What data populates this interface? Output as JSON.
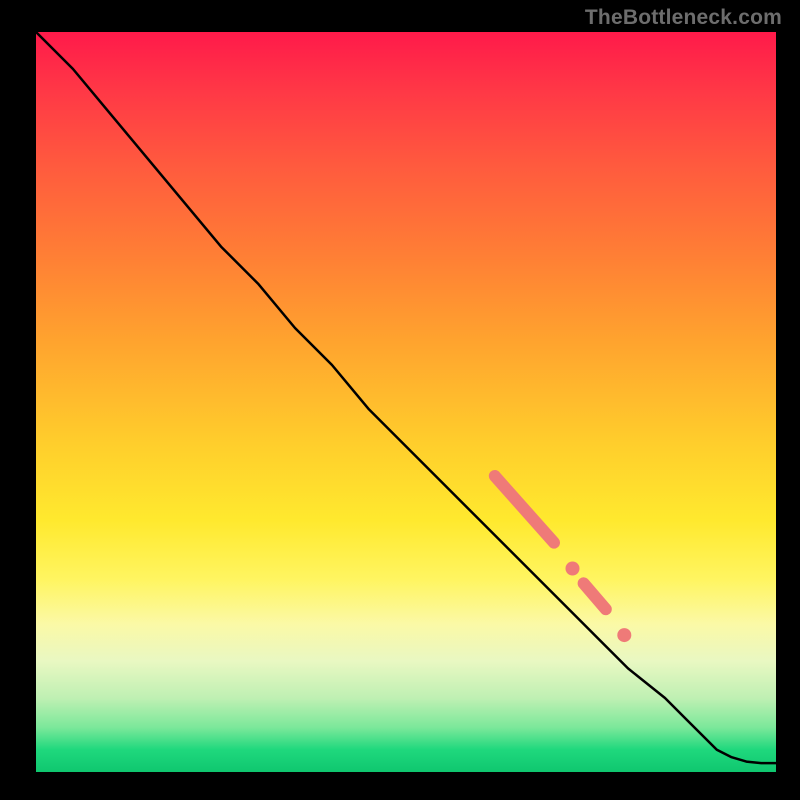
{
  "watermark": "TheBottleneck.com",
  "colors": {
    "line": "#000000",
    "marker": "#ef7a78",
    "gradient_top": "#ff1a4a",
    "gradient_mid": "#ffe92e",
    "gradient_bot": "#0fc76f"
  },
  "chart_data": {
    "type": "line",
    "title": "",
    "xlabel": "",
    "ylabel": "",
    "xlim": [
      0,
      100
    ],
    "ylim": [
      0,
      100
    ],
    "grid": false,
    "series": [
      {
        "name": "curve",
        "x": [
          0,
          5,
          10,
          15,
          20,
          25,
          30,
          35,
          40,
          45,
          50,
          55,
          60,
          65,
          70,
          75,
          80,
          85,
          88,
          90,
          92,
          94,
          96,
          98,
          100
        ],
        "values": [
          100,
          95,
          89,
          83,
          77,
          71,
          66,
          60,
          55,
          49,
          44,
          39,
          34,
          29,
          24,
          19,
          14,
          10,
          7,
          5,
          3,
          2,
          1.4,
          1.2,
          1.2
        ]
      }
    ],
    "markers": [
      {
        "shape": "segment",
        "x0": 62,
        "y0": 40,
        "x1": 70,
        "y1": 31
      },
      {
        "shape": "dot",
        "x": 72.5,
        "y": 27.5
      },
      {
        "shape": "segment",
        "x0": 74,
        "y0": 25.5,
        "x1": 77,
        "y1": 22
      },
      {
        "shape": "dot",
        "x": 79.5,
        "y": 18.5
      }
    ]
  }
}
